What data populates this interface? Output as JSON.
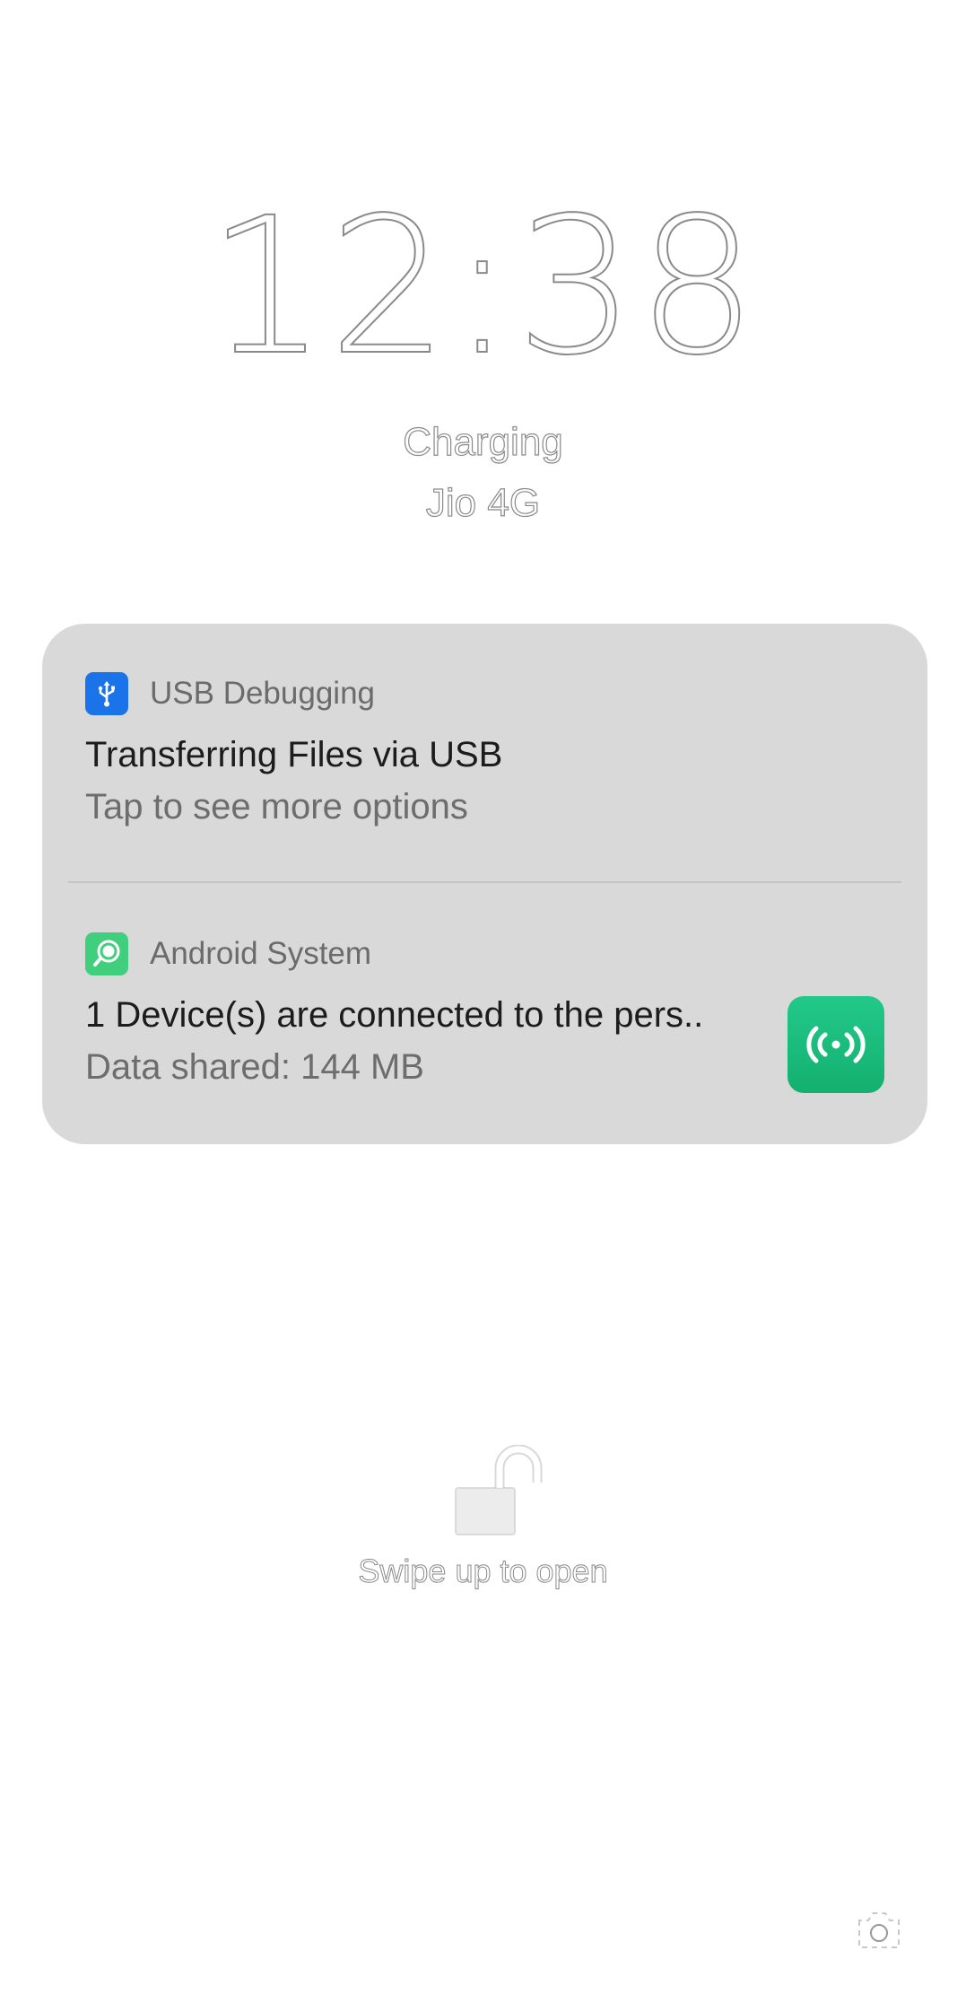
{
  "lockscreen": {
    "time": "12:38",
    "charging_status": "Charging",
    "carrier": "Jio 4G"
  },
  "notifications": [
    {
      "app_name": "USB Debugging",
      "icon": "usb-icon",
      "title": "Transferring Files via USB",
      "text": "Tap to see more options",
      "accent": "#1a73e8"
    },
    {
      "app_name": "Android System",
      "icon": "android-system-icon",
      "title": "1 Device(s) are connected to the pers..",
      "text": "Data shared: 144 MB",
      "thumbnail_icon": "hotspot-icon",
      "accent": "#17bb7b"
    }
  ],
  "unlock": {
    "icon": "unlock-icon",
    "label": "Swipe up to open"
  },
  "shortcuts": {
    "camera_icon": "camera-icon"
  },
  "colors": {
    "background": "#ffffff",
    "card": "#d9d9d9",
    "outline_text": "#8a8a8a"
  }
}
